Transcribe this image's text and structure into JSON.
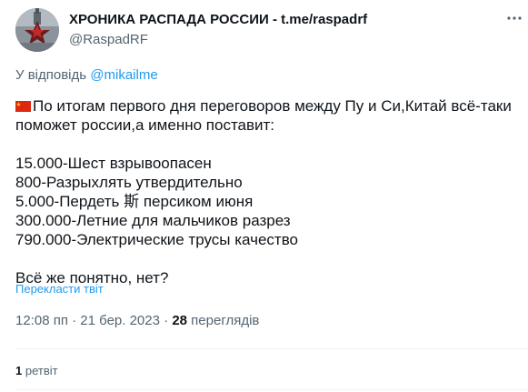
{
  "author": {
    "name": "ХРОНИКА РАСПАДА РОССИИ - t.me/raspadrf",
    "handle": "@RaspadRF"
  },
  "reply": {
    "prefix": "У відповідь ",
    "mention": "@mikailme"
  },
  "tweet": {
    "flag_icon": "china-flag-icon",
    "line1": "По итогам первого дня переговоров между Пу и Си,Китай всё-таки",
    "line2": "поможет россии,а именно поставит:",
    "items": [
      "15.000-Шест взрывоопасен",
      "800-Разрыхлять утвердительно",
      "5.000-Пердеть 斯 персиком июня",
      "300.000-Летние для мальчиков разрез",
      "790.000-Электрические трусы качество"
    ],
    "closing": "Всё же понятно, нет?"
  },
  "translate_label": "Перекласти твіт",
  "meta": {
    "time": "12:08 пп",
    "separator": " · ",
    "date": "21 бер. 2023",
    "views_count": "28",
    "views_label": " переглядів"
  },
  "stats": {
    "retweets_count": "1",
    "retweets_label": " ретвіт"
  },
  "colors": {
    "link": "#1d9bf0",
    "secondary_text": "#536471",
    "primary_text": "#0f1419",
    "flag_red": "#de2910",
    "flag_yellow": "#ffde00"
  }
}
